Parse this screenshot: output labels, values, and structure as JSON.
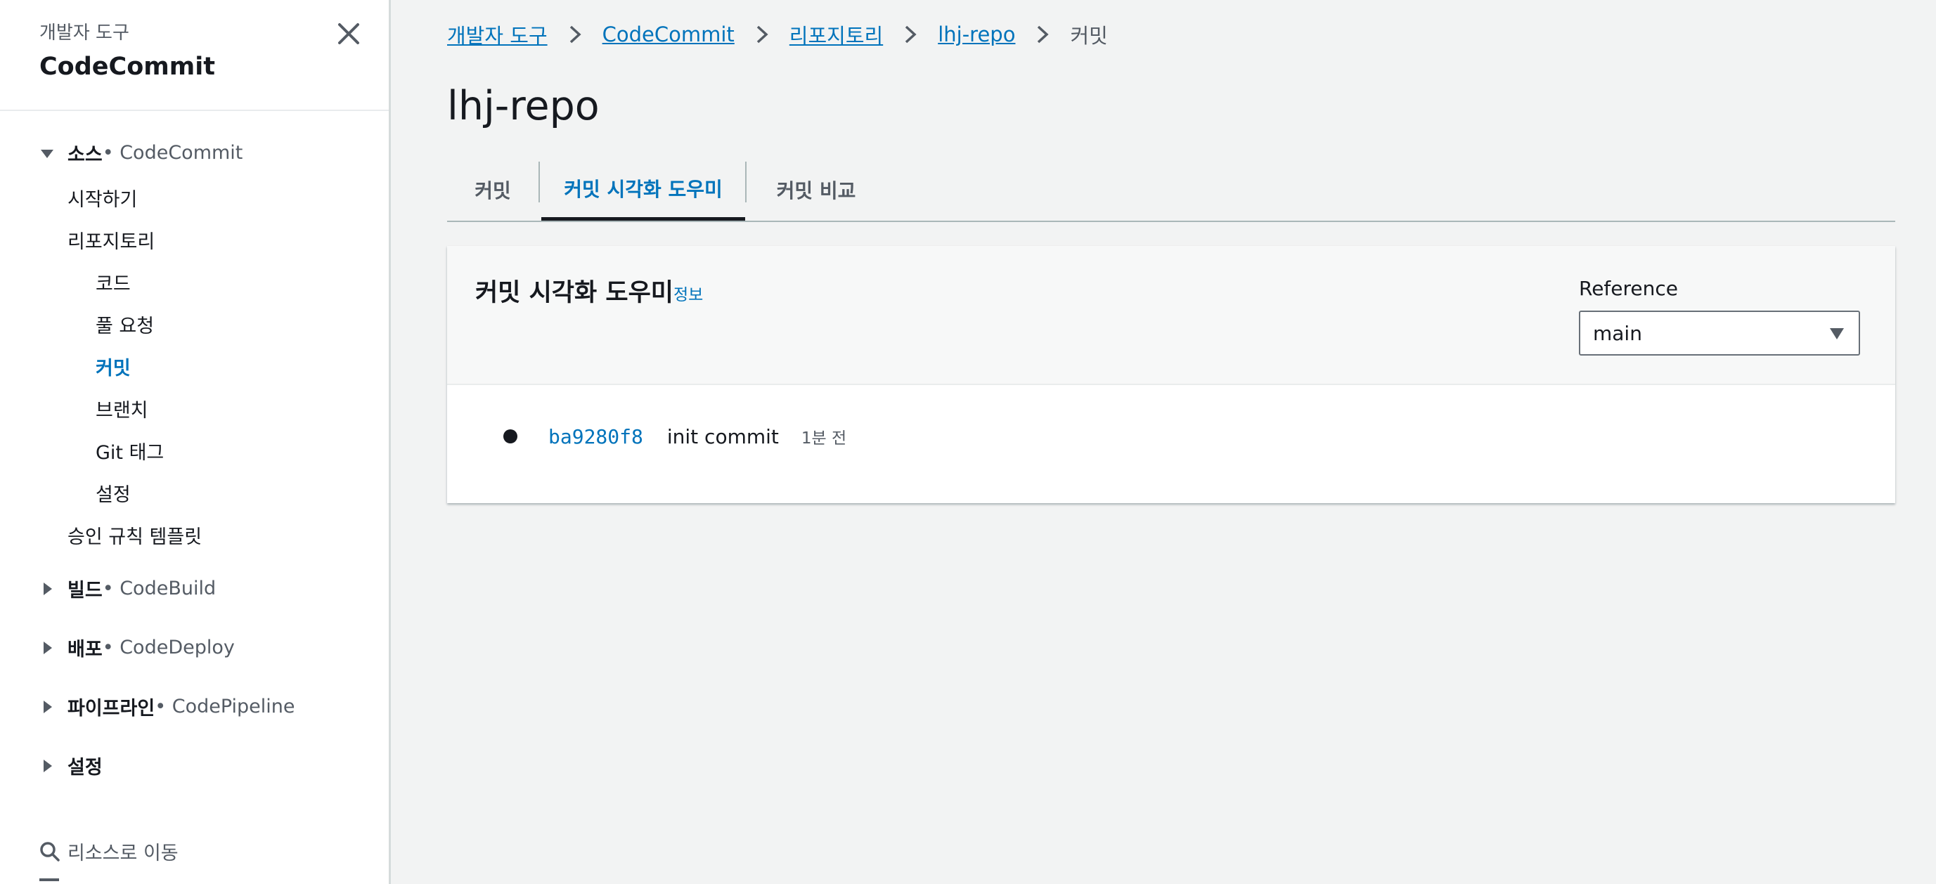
{
  "sidebar": {
    "super_title": "개발자 도구",
    "title": "CodeCommit",
    "sections": [
      {
        "name": "소스",
        "service": " • CodeCommit",
        "expanded": true
      },
      {
        "name": "빌드",
        "service": " • CodeBuild",
        "expanded": false
      },
      {
        "name": "배포",
        "service": " • CodeDeploy",
        "expanded": false
      },
      {
        "name": "파이프라인",
        "service": " • CodePipeline",
        "expanded": false
      },
      {
        "name": "설정",
        "service": "",
        "expanded": false
      }
    ],
    "items": {
      "getting_started": "시작하기",
      "repositories": "리포지토리",
      "code": "코드",
      "pull_requests": "풀 요청",
      "commits": "커밋",
      "branches": "브랜치",
      "git_tags": "Git 태그",
      "settings": "설정",
      "approval_rule_templates": "승인 규칙 템플릿"
    },
    "search_label": "리소스로 이동"
  },
  "breadcrumb": {
    "items": [
      "개발자 도구",
      "CodeCommit",
      "리포지토리",
      "lhj-repo"
    ],
    "current": "커밋"
  },
  "page": {
    "title": "lhj-repo"
  },
  "tabs": [
    {
      "label": "커밋",
      "active": false
    },
    {
      "label": "커밋 시각화 도우미",
      "active": true
    },
    {
      "label": "커밋 비교",
      "active": false
    }
  ],
  "panel": {
    "title": "커밋 시각화 도우미",
    "info_link": "정보",
    "reference_label": "Reference",
    "reference_value": "main"
  },
  "commits": [
    {
      "id": "ba9280f8",
      "message": "init commit",
      "time": "1분 전"
    }
  ],
  "colors": {
    "link": "#0073bb",
    "background": "#f2f3f3",
    "text": "#16191f",
    "muted": "#545b64"
  }
}
